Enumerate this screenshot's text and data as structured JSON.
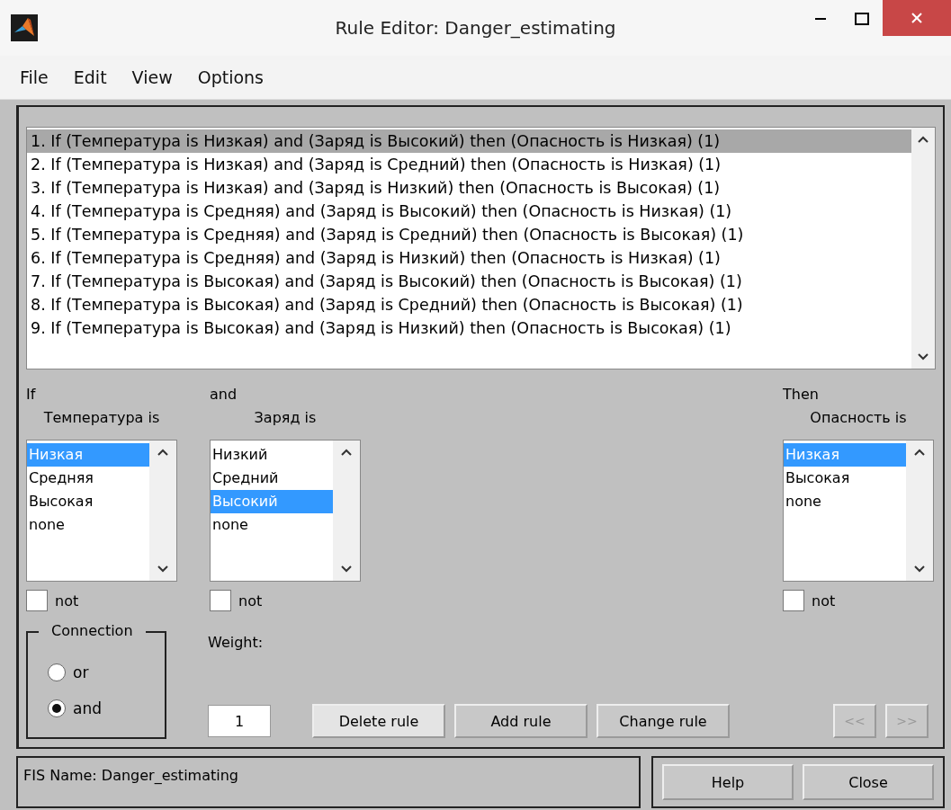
{
  "window": {
    "title": "Rule Editor: Danger_estimating"
  },
  "menu": [
    "File",
    "Edit",
    "View",
    "Options"
  ],
  "rules": [
    {
      "text": "1. If (Температура is Низкая) and (Заряд is Высокий) then (Опасность is Низкая) (1)",
      "selected": true
    },
    {
      "text": "2. If (Температура is Низкая) and (Заряд is Средний) then (Опасность is Низкая) (1)",
      "selected": false
    },
    {
      "text": "3. If (Температура is Низкая) and (Заряд is Низкий) then (Опасность is Высокая) (1)",
      "selected": false
    },
    {
      "text": "4. If (Температура is Средняя) and (Заряд is Высокий) then (Опасность is Низкая) (1)",
      "selected": false
    },
    {
      "text": "5. If (Температура is Средняя) and (Заряд is Средний) then (Опасность is Высокая) (1)",
      "selected": false
    },
    {
      "text": "6. If (Температура is Средняя) and (Заряд is Низкий) then (Опасность is Низкая) (1)",
      "selected": false
    },
    {
      "text": "7. If (Температура is Высокая) and (Заряд is Высокий) then (Опасность is Высокая) (1)",
      "selected": false
    },
    {
      "text": "8. If (Температура is Высокая) and (Заряд is Средний) then (Опасность is Высокая) (1)",
      "selected": false
    },
    {
      "text": "9. If (Температура is Высокая) and (Заряд is Низкий) then (Опасность is Высокая) (1)",
      "selected": false
    }
  ],
  "selectors": [
    {
      "heading": "If",
      "variable": "Температура is",
      "options": [
        {
          "label": "Низкая",
          "selected": true
        },
        {
          "label": "Средняя",
          "selected": false
        },
        {
          "label": "Высокая",
          "selected": false
        },
        {
          "label": "none",
          "selected": false
        }
      ],
      "not": {
        "label": "not",
        "checked": false
      }
    },
    {
      "heading": "and",
      "variable": "Заряд is",
      "options": [
        {
          "label": "Низкий",
          "selected": false
        },
        {
          "label": "Средний",
          "selected": false
        },
        {
          "label": "Высокий",
          "selected": true
        },
        {
          "label": "none",
          "selected": false
        }
      ],
      "not": {
        "label": "not",
        "checked": false
      }
    },
    {
      "heading": "Then",
      "variable": "Опасность is",
      "options": [
        {
          "label": "Низкая",
          "selected": true
        },
        {
          "label": "Высокая",
          "selected": false
        },
        {
          "label": "none",
          "selected": false
        }
      ],
      "not": {
        "label": "not",
        "checked": false
      }
    }
  ],
  "connection": {
    "title": "Connection",
    "options": [
      {
        "label": "or",
        "selected": false
      },
      {
        "label": "and",
        "selected": true
      }
    ]
  },
  "weight": {
    "label": "Weight:",
    "value": "1"
  },
  "rule_buttons": [
    {
      "label": "Delete rule",
      "disabled": false
    },
    {
      "label": "Add rule",
      "disabled": false
    },
    {
      "label": "Change rule",
      "disabled": false
    }
  ],
  "nav_buttons": [
    {
      "label": "<<",
      "disabled": true
    },
    {
      "label": ">>",
      "disabled": true
    }
  ],
  "status": "FIS Name: Danger_estimating",
  "bottom_buttons": [
    "Help",
    "Close"
  ]
}
